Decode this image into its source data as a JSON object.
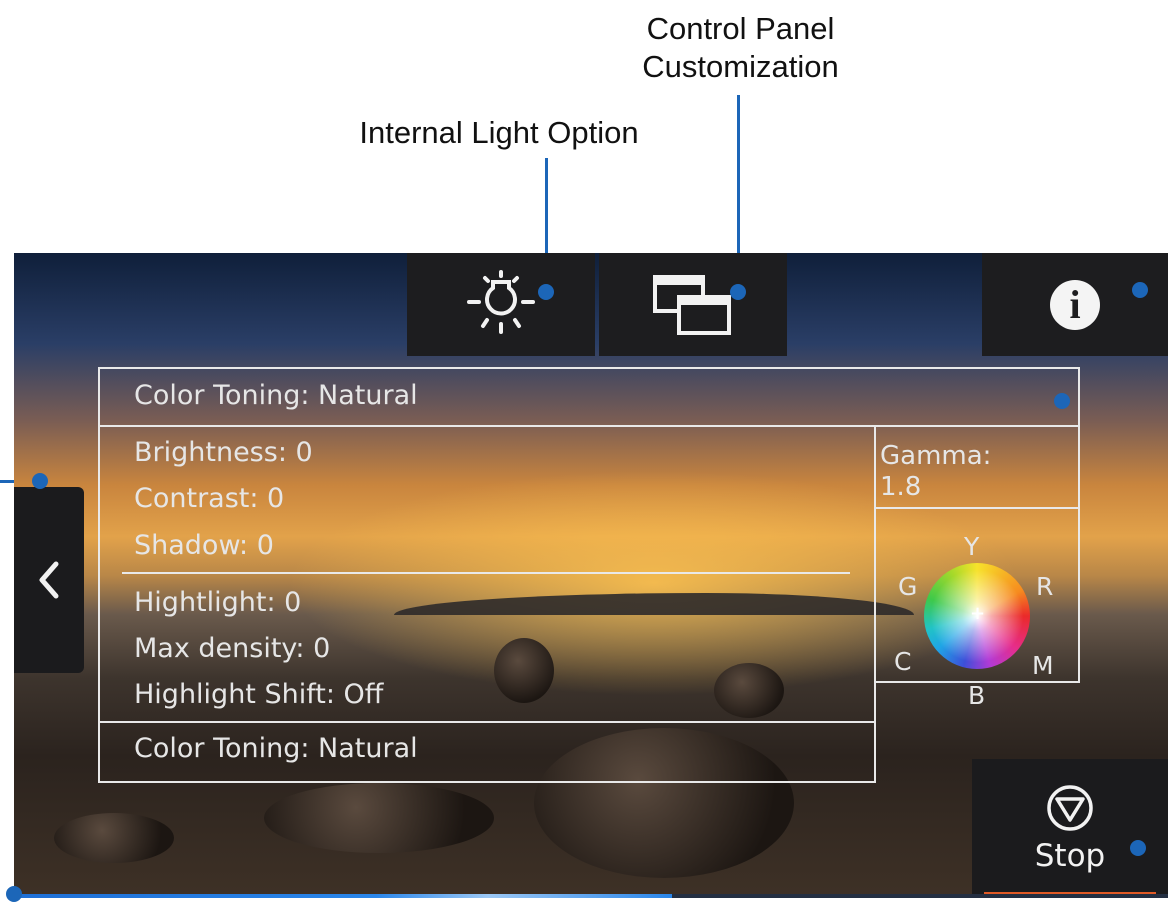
{
  "callouts": {
    "control_panel": "Control Panel\nCustomization",
    "internal_light": "Internal Light Option"
  },
  "panel": {
    "color_toning_top": "Color Toning: Natural",
    "brightness": "Brightness: 0",
    "contrast": "Contrast: 0",
    "shadow": "Shadow: 0",
    "highlight": "Hightlight: 0",
    "max_density": "Max density: 0",
    "highlight_shift": "Highlight Shift: Off",
    "color_toning_bottom": "Color Toning: Natural",
    "gamma_label": "Gamma:",
    "gamma_value": "1.8",
    "wheel": {
      "y": "Y",
      "r": "R",
      "m": "M",
      "b": "B",
      "c": "C",
      "g": "G"
    }
  },
  "buttons": {
    "stop": "Stop"
  },
  "icons": {
    "internal_light": "lightbulb-icon",
    "customization": "windows-icon",
    "info": "info-icon",
    "back": "chevron-left-icon",
    "stop": "stop-triangle-icon"
  },
  "progress": {
    "fraction": 0.57
  },
  "colors": {
    "callout": "#1c66b8",
    "stop_underline": "#e05a26",
    "progress": "#2a86ea"
  }
}
